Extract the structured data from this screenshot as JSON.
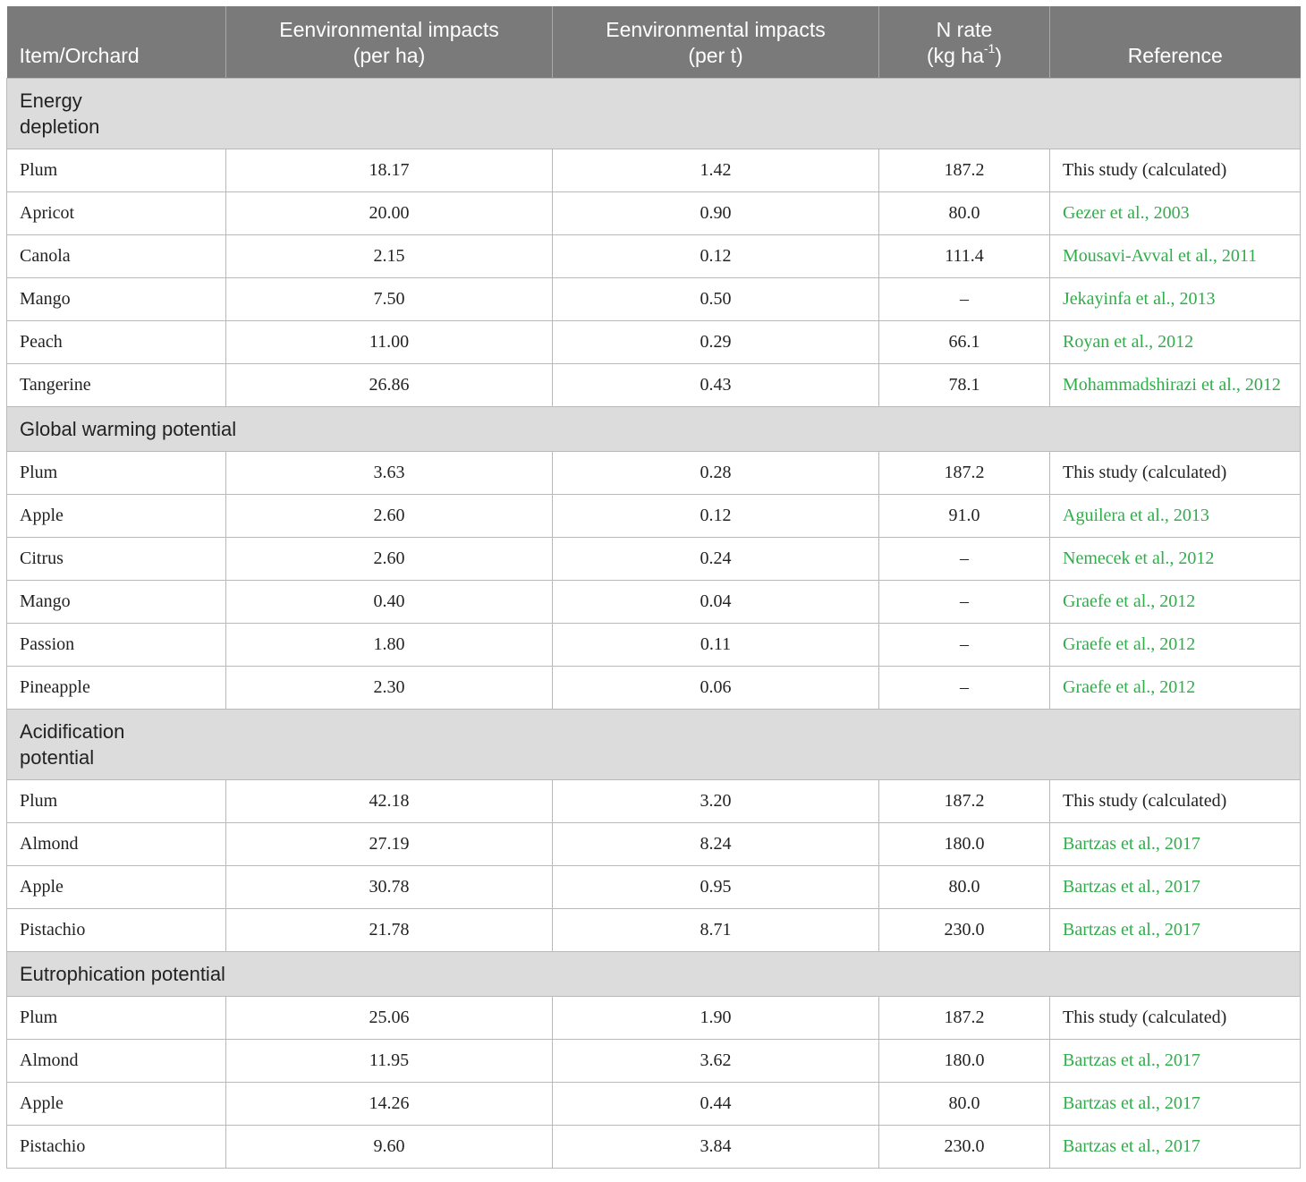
{
  "header": {
    "col1": "Item/Orchard",
    "col2_line1": "Eenvironmental impacts",
    "col2_line2": "(per ha)",
    "col3_line1": "Eenvironmental impacts",
    "col3_line2": "(per t)",
    "col4_line1": "N rate",
    "col4_unit_pre": "(kg ha",
    "col4_sup": "-1",
    "col4_unit_post": ")",
    "col5": "Reference"
  },
  "sections": [
    {
      "label_line1": "Energy",
      "label_line2": "depletion",
      "rows": [
        {
          "item": "Plum",
          "per_ha": "18.17",
          "per_t": "1.42",
          "n_rate": "187.2",
          "reference": "This study (calculated)",
          "ref_link": false
        },
        {
          "item": "Apricot",
          "per_ha": "20.00",
          "per_t": "0.90",
          "n_rate": "80.0",
          "reference": "Gezer et al., 2003",
          "ref_link": true
        },
        {
          "item": "Canola",
          "per_ha": "2.15",
          "per_t": "0.12",
          "n_rate": "111.4",
          "reference": "Mousavi-Avval et al., 2011",
          "ref_link": true
        },
        {
          "item": "Mango",
          "per_ha": "7.50",
          "per_t": "0.50",
          "n_rate": "–",
          "reference": "Jekayinfa et al., 2013",
          "ref_link": true
        },
        {
          "item": "Peach",
          "per_ha": "11.00",
          "per_t": "0.29",
          "n_rate": "66.1",
          "reference": "Royan et al., 2012",
          "ref_link": true
        },
        {
          "item": "Tangerine",
          "per_ha": "26.86",
          "per_t": "0.43",
          "n_rate": "78.1",
          "reference": "Mohammadshirazi et al., 2012",
          "ref_link": true
        }
      ]
    },
    {
      "label_line1": "Global warming potential",
      "label_line2": "",
      "rows": [
        {
          "item": "Plum",
          "per_ha": "3.63",
          "per_t": "0.28",
          "n_rate": "187.2",
          "reference": "This study (calculated)",
          "ref_link": false
        },
        {
          "item": "Apple",
          "per_ha": "2.60",
          "per_t": "0.12",
          "n_rate": "91.0",
          "reference": "Aguilera et al., 2013",
          "ref_link": true
        },
        {
          "item": "Citrus",
          "per_ha": "2.60",
          "per_t": "0.24",
          "n_rate": "–",
          "reference": "Nemecek et al., 2012",
          "ref_link": true
        },
        {
          "item": "Mango",
          "per_ha": "0.40",
          "per_t": "0.04",
          "n_rate": "–",
          "reference": "Graefe et al., 2012",
          "ref_link": true
        },
        {
          "item": "Passion",
          "per_ha": "1.80",
          "per_t": "0.11",
          "n_rate": "–",
          "reference": "Graefe et al., 2012",
          "ref_link": true
        },
        {
          "item": "Pineapple",
          "per_ha": "2.30",
          "per_t": "0.06",
          "n_rate": "–",
          "reference": "Graefe et al., 2012",
          "ref_link": true
        }
      ]
    },
    {
      "label_line1": "Acidification",
      "label_line2": "potential",
      "rows": [
        {
          "item": "Plum",
          "per_ha": "42.18",
          "per_t": "3.20",
          "n_rate": "187.2",
          "reference": "This study (calculated)",
          "ref_link": false
        },
        {
          "item": "Almond",
          "per_ha": "27.19",
          "per_t": "8.24",
          "n_rate": "180.0",
          "reference": "Bartzas et al., 2017",
          "ref_link": true
        },
        {
          "item": "Apple",
          "per_ha": "30.78",
          "per_t": "0.95",
          "n_rate": "80.0",
          "reference": "Bartzas et al., 2017",
          "ref_link": true
        },
        {
          "item": "Pistachio",
          "per_ha": "21.78",
          "per_t": "8.71",
          "n_rate": "230.0",
          "reference": "Bartzas et al., 2017",
          "ref_link": true
        }
      ]
    },
    {
      "label_line1": "Eutrophication potential",
      "label_line2": "",
      "rows": [
        {
          "item": "Plum",
          "per_ha": "25.06",
          "per_t": "1.90",
          "n_rate": "187.2",
          "reference": "This study (calculated)",
          "ref_link": false
        },
        {
          "item": "Almond",
          "per_ha": "11.95",
          "per_t": "3.62",
          "n_rate": "180.0",
          "reference": "Bartzas et al., 2017",
          "ref_link": true
        },
        {
          "item": "Apple",
          "per_ha": "14.26",
          "per_t": "0.44",
          "n_rate": "80.0",
          "reference": "Bartzas et al., 2017",
          "ref_link": true
        },
        {
          "item": "Pistachio",
          "per_ha": "9.60",
          "per_t": "3.84",
          "n_rate": "230.0",
          "reference": "Bartzas et al., 2017",
          "ref_link": true
        }
      ]
    }
  ]
}
